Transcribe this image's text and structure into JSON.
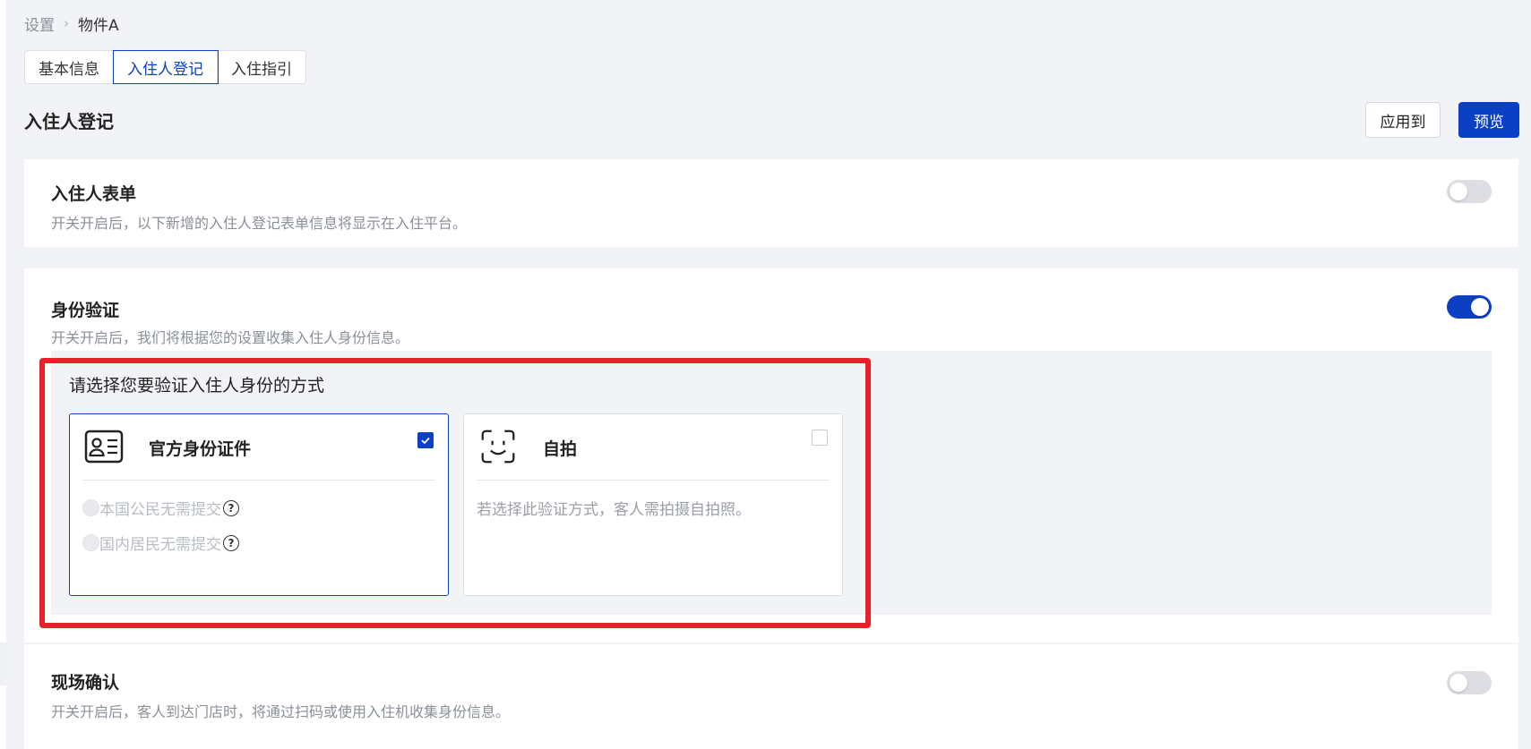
{
  "breadcrumb": {
    "parent": "设置",
    "separator": "›",
    "current": "物件A"
  },
  "tabs": [
    {
      "label": "基本信息",
      "active": false
    },
    {
      "label": "入住人登记",
      "active": true
    },
    {
      "label": "入住指引",
      "active": false
    }
  ],
  "header": {
    "title": "入住人登记",
    "apply_label": "应用到",
    "preview_label": "预览"
  },
  "sections": {
    "guest_form": {
      "title": "入住人表单",
      "description": "开关开启后，以下新增的入住人登记表单信息将显示在入住平台。",
      "enabled": false
    },
    "identity": {
      "title": "身份验证",
      "description": "开关开启后，我们将根据您的设置收集入住人身份信息。",
      "enabled": true,
      "prompt": "请选择您要验证入住人身份的方式",
      "methods": {
        "official_id": {
          "title": "官方身份证件",
          "checked": true,
          "options": [
            {
              "label": "本国公民无需提交",
              "help": "?"
            },
            {
              "label": "国内居民无需提交",
              "help": "?"
            }
          ]
        },
        "selfie": {
          "title": "自拍",
          "checked": false,
          "description": "若选择此验证方式，客人需拍摄自拍照。"
        }
      }
    },
    "onsite": {
      "title": "现场确认",
      "description": "开关开启后，客人到达门店时，将通过扫码或使用入住机收集身份信息。",
      "enabled": false
    }
  },
  "colors": {
    "accent": "#0b3fc4",
    "highlight": "#e8202a",
    "background": "#f2f3f6"
  }
}
